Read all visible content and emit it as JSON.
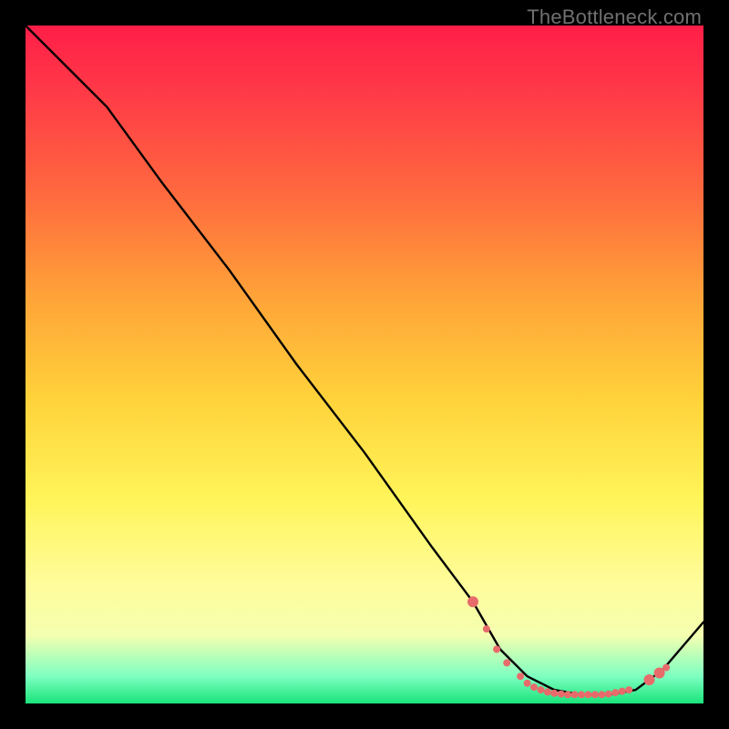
{
  "watermark": "TheBottleneck.com",
  "chart_data": {
    "type": "line",
    "title": "",
    "xlabel": "",
    "ylabel": "",
    "xlim": [
      0,
      100
    ],
    "ylim": [
      0,
      100
    ],
    "series": [
      {
        "name": "curve",
        "color": "#000000",
        "x": [
          0,
          8,
          12,
          20,
          30,
          40,
          50,
          60,
          66,
          70,
          74,
          78,
          82,
          86,
          90,
          94,
          100
        ],
        "values": [
          100,
          92,
          88,
          77,
          64,
          50,
          37,
          23,
          15,
          8,
          4,
          2,
          1.3,
          1.3,
          2,
          5,
          12
        ]
      }
    ],
    "markers": {
      "name": "bottom-dots",
      "color": "#e86b6b",
      "radius_small": 4,
      "radius_large": 6,
      "points": [
        {
          "x": 66,
          "y": 15,
          "r": 6
        },
        {
          "x": 68,
          "y": 11,
          "r": 4
        },
        {
          "x": 69.5,
          "y": 8,
          "r": 4
        },
        {
          "x": 71,
          "y": 6,
          "r": 4
        },
        {
          "x": 73,
          "y": 4,
          "r": 4
        },
        {
          "x": 74,
          "y": 3,
          "r": 4
        },
        {
          "x": 75,
          "y": 2.4,
          "r": 4
        },
        {
          "x": 76,
          "y": 2,
          "r": 4
        },
        {
          "x": 77,
          "y": 1.7,
          "r": 4
        },
        {
          "x": 78,
          "y": 1.5,
          "r": 4
        },
        {
          "x": 79,
          "y": 1.4,
          "r": 4
        },
        {
          "x": 80,
          "y": 1.3,
          "r": 4
        },
        {
          "x": 81,
          "y": 1.3,
          "r": 4
        },
        {
          "x": 82,
          "y": 1.3,
          "r": 4
        },
        {
          "x": 83,
          "y": 1.3,
          "r": 4
        },
        {
          "x": 84,
          "y": 1.3,
          "r": 4
        },
        {
          "x": 85,
          "y": 1.3,
          "r": 4
        },
        {
          "x": 86,
          "y": 1.4,
          "r": 4
        },
        {
          "x": 87,
          "y": 1.6,
          "r": 4
        },
        {
          "x": 88,
          "y": 1.8,
          "r": 4
        },
        {
          "x": 89,
          "y": 2,
          "r": 4
        },
        {
          "x": 92,
          "y": 3.5,
          "r": 6
        },
        {
          "x": 93.5,
          "y": 4.5,
          "r": 6
        },
        {
          "x": 94.5,
          "y": 5.3,
          "r": 4
        }
      ]
    }
  }
}
